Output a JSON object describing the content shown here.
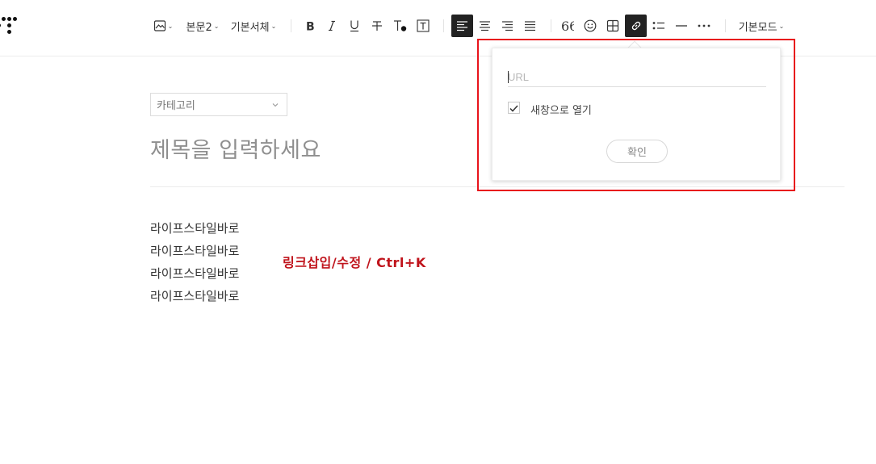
{
  "toolbar": {
    "paragraph_style": "본문2",
    "font_family": "기본서체",
    "mode": "기본모드"
  },
  "editor": {
    "category_placeholder": "카테고리",
    "title_placeholder": "제목을 입력하세요",
    "body_lines": [
      "라이프스타일바로",
      "라이프스타일바로",
      "라이프스타일바로",
      "라이프스타일바로"
    ]
  },
  "annotation": {
    "text": "링크삽입/수정 / Ctrl+K",
    "color": "#c0141c"
  },
  "link_popup": {
    "url_placeholder": "URL",
    "open_new_window_label": "새창으로 열기",
    "open_new_window_checked": true,
    "confirm_label": "확인"
  },
  "colors": {
    "active_button_bg": "#222222",
    "highlight_border": "#e8141c"
  }
}
